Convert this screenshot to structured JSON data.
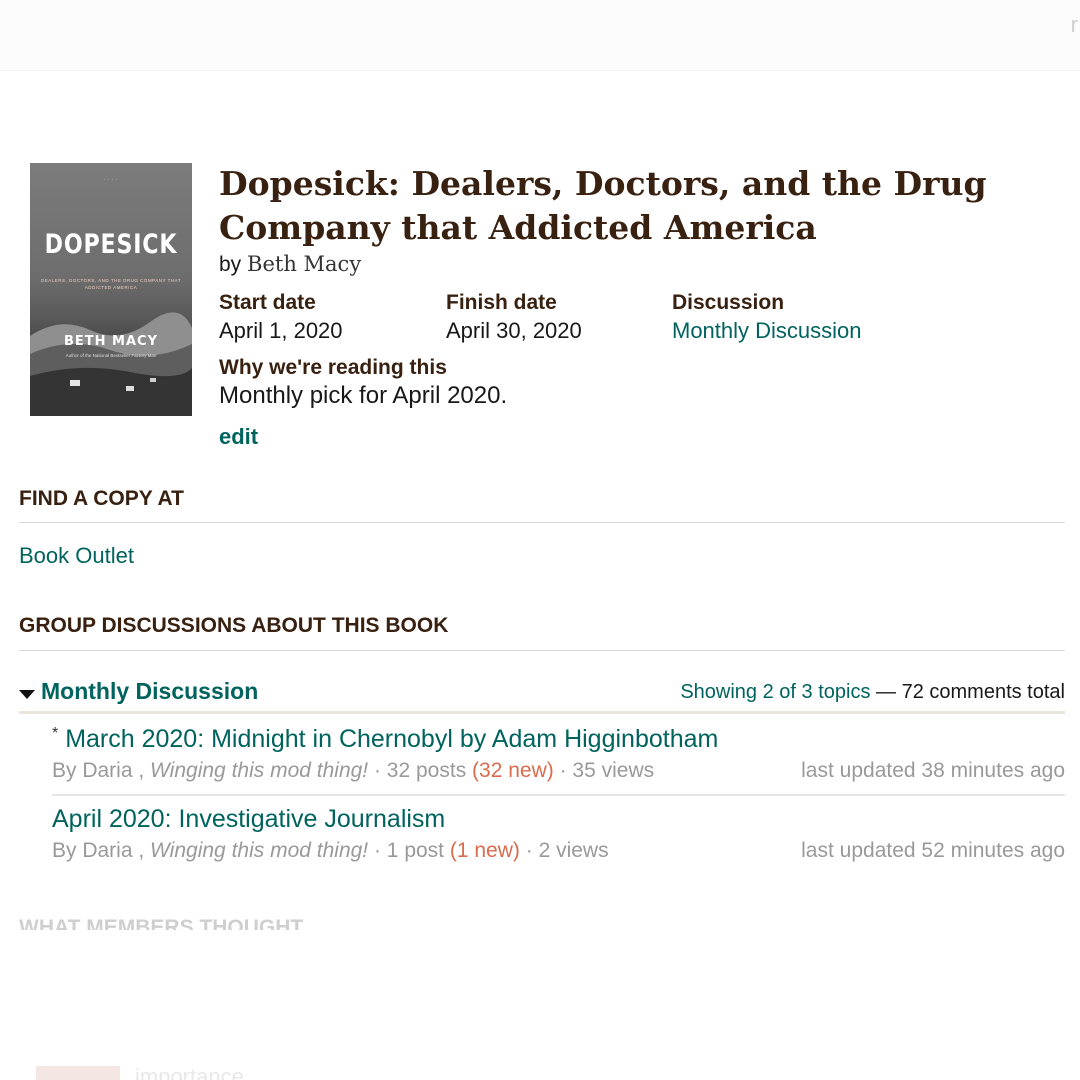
{
  "topbar": {
    "glyph": "r"
  },
  "cover": {
    "top_text": "· · · ·",
    "title": "DOPESICK",
    "subtitle": "DEALERS, DOCTORS, AND THE DRUG COMPANY THAT ADDICTED AMERICA",
    "author": "BETH MACY",
    "blurb": "Author of the National Bestseller Factory Man"
  },
  "book": {
    "title": "Dopesick: Dealers, Doctors, and the Drug Company that Addicted America",
    "by": "by",
    "author": "Beth Macy"
  },
  "meta": {
    "start_label": "Start date",
    "start_value": "April 1, 2020",
    "finish_label": "Finish date",
    "finish_value": "April 30, 2020",
    "discussion_label": "Discussion",
    "discussion_value": "Monthly Discussion"
  },
  "why": {
    "label": "Why we're reading this",
    "value": "Monthly pick for April 2020."
  },
  "edit_label": "edit",
  "find_copy": {
    "heading": "FIND A COPY AT",
    "stores": [
      "Book Outlet"
    ]
  },
  "group_discussions": {
    "heading": "GROUP DISCUSSIONS ABOUT THIS BOOK",
    "folder_title": "Monthly Discussion",
    "showing": "Showing 2 of 3 topics",
    "dash": "—",
    "total": "72 comments total",
    "topics": [
      {
        "star": "*",
        "title": "March 2020: Midnight in Chernobyl by Adam Higginbotham",
        "by": "By Daria ,",
        "signature": "Winging this mod thing!",
        "posts": "· 32 posts",
        "new": "(32 new)",
        "views": "· 35 views",
        "updated": "last updated 38 minutes ago"
      },
      {
        "star": "",
        "title": "April 2020: Investigative Journalism",
        "by": "By Daria ,",
        "signature": "Winging this mod thing!",
        "posts": "· 1 post",
        "new": "(1 new)",
        "views": "· 2 views",
        "updated": "last updated 52 minutes ago"
      }
    ]
  },
  "next_section_heading": "WHAT MEMBERS THOUGHT",
  "bottom_faded_text": "importance",
  "colors": {
    "link": "#00635d",
    "heading": "#382110",
    "new_count": "#d86c4d",
    "muted": "#999999"
  },
  "icons": {
    "folder_toggle": "caret-down-icon"
  }
}
